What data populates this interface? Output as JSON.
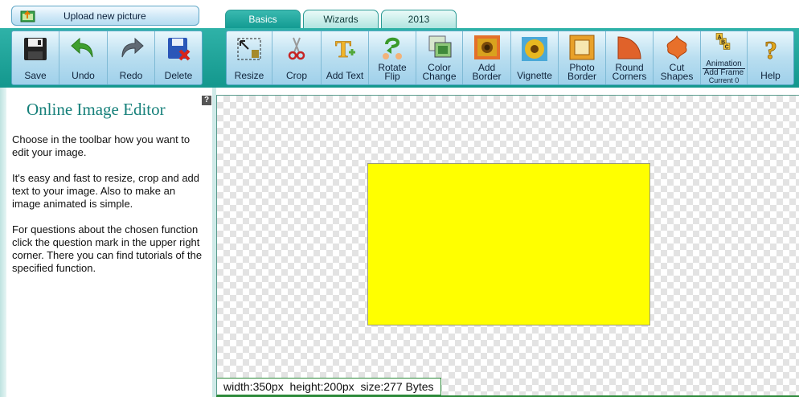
{
  "upload": {
    "label": "Upload new picture",
    "icon": "upload-picture-icon"
  },
  "tabs": [
    {
      "label": "Basics",
      "active": true
    },
    {
      "label": "Wizards",
      "active": false
    },
    {
      "label": "2013",
      "active": false
    }
  ],
  "toolbar": {
    "left_tools": [
      {
        "label": "Save",
        "icon": "floppy-disk-icon"
      },
      {
        "label": "Undo",
        "icon": "undo-arrow-icon"
      },
      {
        "label": "Redo",
        "icon": "redo-arrow-icon"
      },
      {
        "label": "Delete",
        "icon": "delete-disk-icon"
      }
    ],
    "right_tools": [
      {
        "label": "Resize",
        "icon": "resize-icon"
      },
      {
        "label": "Crop",
        "icon": "scissors-icon"
      },
      {
        "label": "Add Text",
        "icon": "add-text-icon"
      },
      {
        "label": "Rotate\nFlip",
        "icon": "rotate-flip-icon"
      },
      {
        "label": "Color\nChange",
        "icon": "color-change-icon"
      },
      {
        "label": "Add\nBorder",
        "icon": "add-border-icon"
      },
      {
        "label": "Vignette",
        "icon": "vignette-icon"
      },
      {
        "label": "Photo\nBorder",
        "icon": "photo-border-icon"
      },
      {
        "label": "Round\nCorners",
        "icon": "round-corners-icon"
      },
      {
        "label": "Cut\nShapes",
        "icon": "cut-shapes-icon"
      },
      {
        "label": "Animation",
        "icon": "animation-abc-icon",
        "sub1": "Add Frame",
        "sub2": "Current 0"
      },
      {
        "label": "Help",
        "icon": "question-mark-icon"
      }
    ]
  },
  "panel": {
    "help": "?",
    "title": "Online Image Editor",
    "paragraphs": [
      "Choose in the toolbar how you want to edit your image.",
      "It's easy and fast to resize, crop and add text to your image. Also to make an image animated is simple.",
      "For questions about the chosen function click the question mark in the upper right corner. There you can find tutorials of the specified function."
    ]
  },
  "canvas": {
    "image_color": "#ffff00",
    "status": "width:350px  height:200px  size:277 Bytes"
  },
  "colors": {
    "accent": "#16807a",
    "toolbar": "#13978d"
  }
}
